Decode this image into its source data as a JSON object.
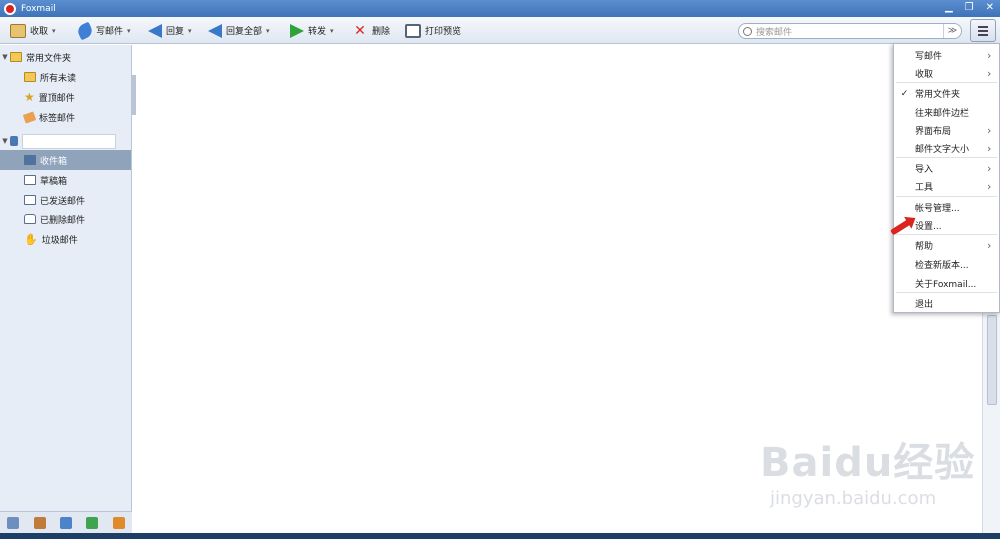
{
  "window": {
    "title": "Foxmail",
    "min": "▁",
    "restore": "❐",
    "close": "✕"
  },
  "toolbar": {
    "receive": "收取",
    "write": "写邮件",
    "reply": "回复",
    "reply_all": "回复全部",
    "forward": "转发",
    "delete": "删除",
    "print_preview": "打印预览",
    "caret": "▾"
  },
  "search": {
    "placeholder": "搜索邮件",
    "dropdown": "≫"
  },
  "sidebar": {
    "favorites": {
      "label": "常用文件夹",
      "items": [
        {
          "label": "所有未读",
          "icon": "folder-icon"
        },
        {
          "label": "置顶邮件",
          "icon": "star-icon"
        },
        {
          "label": "标签邮件",
          "icon": "tag-icon"
        }
      ]
    },
    "account": {
      "items": [
        {
          "label": "收件箱",
          "icon": "inbox-icon",
          "selected": true
        },
        {
          "label": "草稿箱",
          "icon": "drafts-icon"
        },
        {
          "label": "已发送邮件",
          "icon": "sent-icon"
        },
        {
          "label": "已删除邮件",
          "icon": "trash-icon"
        },
        {
          "label": "垃圾邮件",
          "icon": "junk-icon"
        }
      ]
    }
  },
  "menu": {
    "items": [
      {
        "label": "写邮件",
        "submenu": true
      },
      {
        "label": "收取",
        "submenu": true
      },
      {
        "label": "常用文件夹",
        "checked": true
      },
      {
        "label": "往来邮件边栏"
      },
      {
        "label": "界面布局",
        "submenu": true
      },
      {
        "label": "邮件文字大小",
        "submenu": true
      },
      {
        "label": "导入",
        "submenu": true
      },
      {
        "label": "工具",
        "submenu": true
      },
      {
        "label": "帐号管理..."
      },
      {
        "label": "设置..."
      },
      {
        "label": "帮助",
        "submenu": true
      },
      {
        "label": "检查新版本..."
      },
      {
        "label": "关于Foxmail..."
      },
      {
        "label": "退出"
      }
    ],
    "check_mark": "✓",
    "submenu_mark": "›"
  },
  "watermark": {
    "main": "Baidu经验",
    "sub": "jingyan.baidu.com"
  },
  "colors": {
    "titlebar": "#4a7fc2",
    "selected_row": "#8fa3bb",
    "arrow": "#d9251d"
  }
}
